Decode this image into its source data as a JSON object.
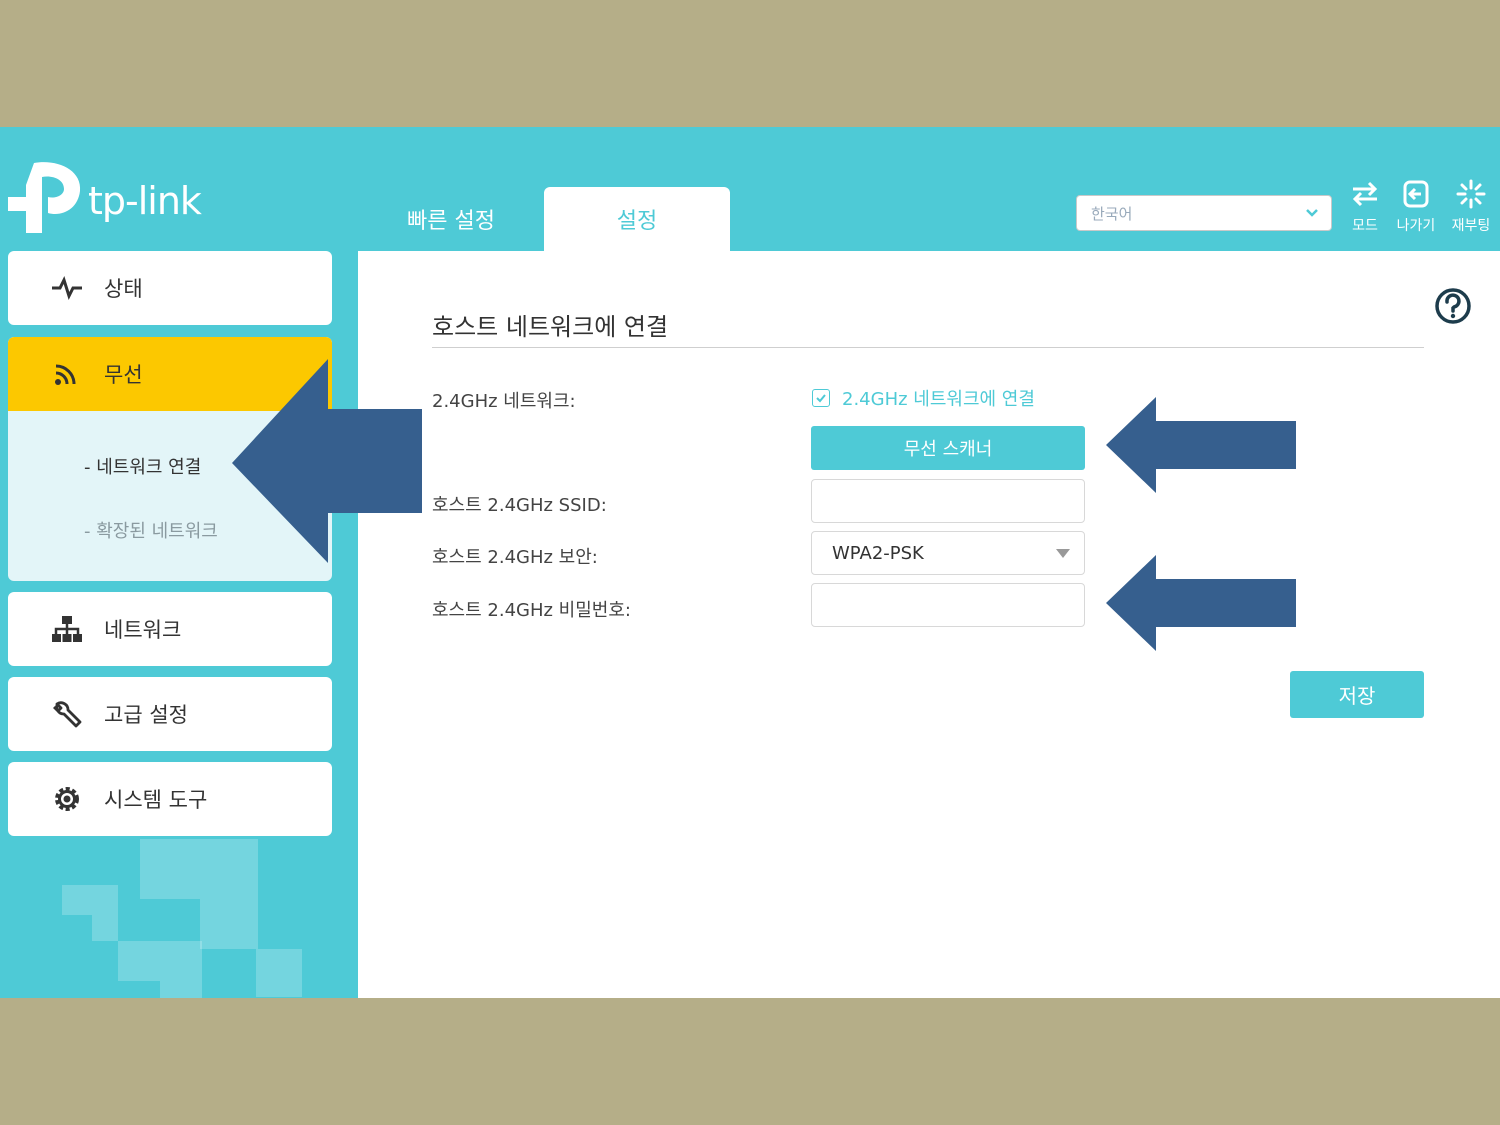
{
  "brand": {
    "name": "tp-link"
  },
  "tabs": [
    {
      "label": "빠른 설정",
      "active": false
    },
    {
      "label": "설정",
      "active": true
    }
  ],
  "language": {
    "selected": "한국어"
  },
  "header_actions": [
    {
      "label": "모드",
      "icon": "mode-switch-icon"
    },
    {
      "label": "나가기",
      "icon": "logout-icon"
    },
    {
      "label": "재부팅",
      "icon": "reboot-icon"
    }
  ],
  "sidebar": {
    "items": [
      {
        "label": "상태",
        "icon": "pulse-icon"
      },
      {
        "label": "무선",
        "icon": "wireless-icon",
        "active": true,
        "subitems": [
          {
            "label": "- 네트워크 연결",
            "active": true
          },
          {
            "label": "- 확장된 네트워크",
            "active": false
          }
        ]
      },
      {
        "label": "네트워크",
        "icon": "network-icon"
      },
      {
        "label": "고급 설정",
        "icon": "wrench-icon"
      },
      {
        "label": "시스템 도구",
        "icon": "gear-icon"
      }
    ]
  },
  "main": {
    "title": "호스트 네트워크에 연결",
    "fields": {
      "network_label": "2.4GHz 네트워크:",
      "connect_checkbox_label": "2.4GHz 네트워크에 연결",
      "connect_checked": true,
      "scanner_button": "무선 스캐너",
      "ssid_label": "호스트 2.4GHz SSID:",
      "ssid_value": "",
      "security_label": "호스트 2.4GHz 보안:",
      "security_value": "WPA2-PSK",
      "password_label": "호스트 2.4GHz 비밀번호:",
      "password_value": ""
    },
    "save_button": "저장"
  },
  "colors": {
    "teal": "#4ecad6",
    "active_yellow": "#fcc800",
    "annotation_arrow": "#365f8e",
    "frame": "#b5ae88"
  }
}
